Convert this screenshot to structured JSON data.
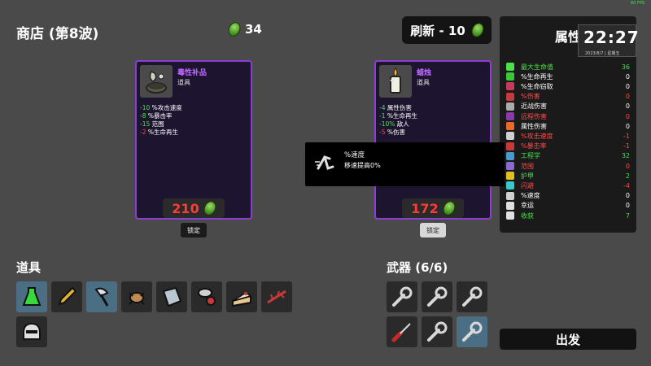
{
  "header": {
    "shop_title": "商店 (第8波)",
    "materials": "34",
    "reroll_label": "刷新 - 10"
  },
  "fps": "60 FPS",
  "clock": {
    "time": "22:27",
    "date": "2023/8/7 | 星期五"
  },
  "stats": {
    "title": "属性",
    "rows": [
      {
        "label": "最大生命值",
        "value": "36",
        "color": "#4ae04a",
        "icon_color": "#4ae04a",
        "icon": "heart-icon"
      },
      {
        "label": "%生命再生",
        "value": "0",
        "color": "#ffffff",
        "icon_color": "#3ac83a",
        "icon": "regen-icon"
      },
      {
        "label": "%生命窃取",
        "value": "0",
        "color": "#ffffff",
        "icon_color": "#c83a5a",
        "icon": "lifesteal-icon"
      },
      {
        "label": "%伤害",
        "value": "0",
        "color": "#ff4a4a",
        "icon_color": "#c83a3a",
        "icon": "damage-icon"
      },
      {
        "label": "近战伤害",
        "value": "0",
        "color": "#ffffff",
        "icon_color": "#aaaaaa",
        "icon": "melee-icon"
      },
      {
        "label": "远程伤害",
        "value": "0",
        "color": "#ff4a4a",
        "icon_color": "#8a3aa8",
        "icon": "ranged-icon"
      },
      {
        "label": "属性伤害",
        "value": "0",
        "color": "#ffffff",
        "icon_color": "#e86a2a",
        "icon": "elemental-icon"
      },
      {
        "label": "%攻击速度",
        "value": "-1",
        "color": "#ff4a4a",
        "icon_color": "#d0d0d0",
        "icon": "attack-speed-icon"
      },
      {
        "label": "%暴击率",
        "value": "-1",
        "color": "#ff4a4a",
        "icon_color": "#c83a3a",
        "icon": "crit-icon"
      },
      {
        "label": "工程学",
        "value": "32",
        "color": "#4ae04a",
        "icon_color": "#4a9ad0",
        "icon": "engineering-icon"
      },
      {
        "label": "范围",
        "value": "0",
        "color": "#ff4a4a",
        "icon_color": "#8a6ad0",
        "icon": "range-icon"
      },
      {
        "label": "护甲",
        "value": "2",
        "color": "#4ae04a",
        "icon_color": "#e0c020",
        "icon": "armor-icon"
      },
      {
        "label": "闪避",
        "value": "-4",
        "color": "#ff4a4a",
        "icon_color": "#3ac8c8",
        "icon": "dodge-icon"
      },
      {
        "label": "%速度",
        "value": "0",
        "color": "#ffffff",
        "icon_color": "#d0d0d0",
        "icon": "speed-icon"
      },
      {
        "label": "幸运",
        "value": "0",
        "color": "#ffffff",
        "icon_color": "#e0e0e0",
        "icon": "luck-icon"
      },
      {
        "label": "收获",
        "value": "7",
        "color": "#4ae04a",
        "icon_color": "#e0e0e0",
        "icon": "harvesting-icon"
      }
    ]
  },
  "cards": [
    {
      "name": "毒性补品",
      "type": "道具",
      "icon": "toxic-tonic-icon",
      "stats": [
        {
          "value": "-10",
          "label": " %攻击速度"
        },
        {
          "value": "-8",
          "label": " %暴击率"
        },
        {
          "value": "-15",
          "label": " 范围"
        },
        {
          "value": "-2",
          "label": " %生命再生"
        }
      ],
      "price": "210",
      "lock_label": "锁定"
    },
    {
      "name": "蜡烛",
      "type": "道具",
      "icon": "candle-icon",
      "stats": [
        {
          "value": "-4",
          "label": " 属性伤害"
        },
        {
          "value": "-1",
          "label": " %生命再生"
        },
        {
          "value": "-10%",
          "label": " 敌人"
        },
        {
          "value": "-5",
          "label": " %伤害"
        }
      ],
      "price": "172",
      "lock_label": "锁定"
    }
  ],
  "tooltip": {
    "name": "%速度",
    "desc": "移速提高0%"
  },
  "items": {
    "title": "道具",
    "slots": [
      {
        "icon": "potion-icon",
        "highlight": true
      },
      {
        "icon": "pencil-icon",
        "highlight": false
      },
      {
        "icon": "axe-icon",
        "highlight": true
      },
      {
        "icon": "bug-icon",
        "highlight": false
      },
      {
        "icon": "book-icon",
        "highlight": false
      },
      {
        "icon": "mushroom-icon",
        "highlight": false
      },
      {
        "icon": "cake-icon",
        "highlight": false
      },
      {
        "icon": "thorns-icon",
        "highlight": false
      },
      {
        "icon": "helmet-icon",
        "highlight": false
      }
    ]
  },
  "weapons": {
    "title": "武器 (6/6)",
    "slots": [
      {
        "icon": "wrench-icon",
        "highlight": false
      },
      {
        "icon": "wrench-icon",
        "highlight": false
      },
      {
        "icon": "wrench-icon",
        "highlight": false
      },
      {
        "icon": "screwdriver-icon",
        "highlight": false
      },
      {
        "icon": "wrench-icon",
        "highlight": false
      },
      {
        "icon": "wrench-icon",
        "highlight": true
      }
    ]
  },
  "start_label": "出发",
  "colors": {
    "background": "#4a4a4a",
    "card_border": "#8a3fd0",
    "price": "#ff3a3a",
    "positive": "#4ae04a",
    "negative": "#ff4a4a"
  }
}
